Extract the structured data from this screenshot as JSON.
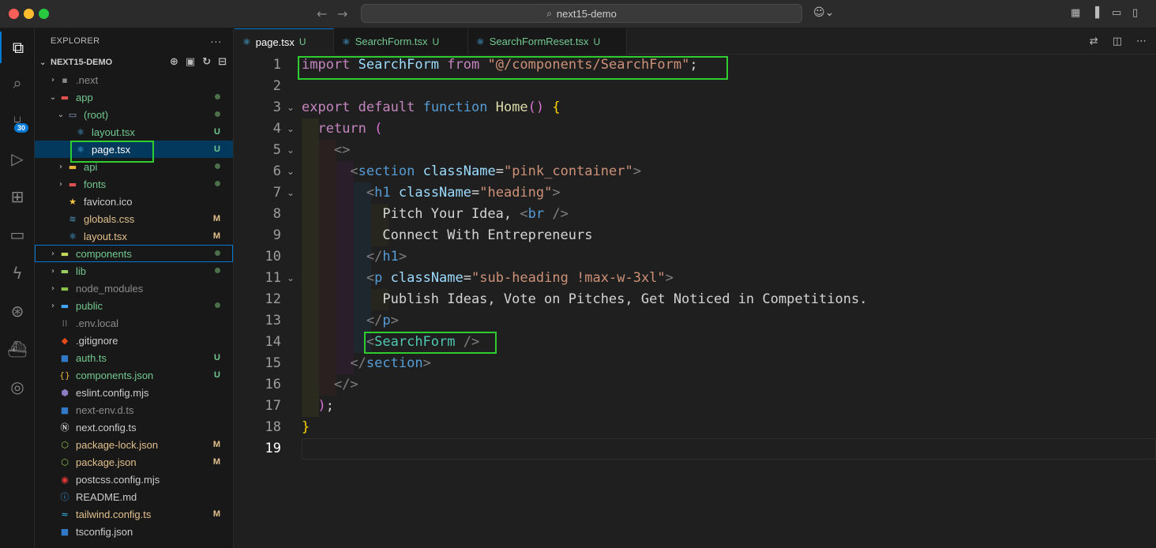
{
  "titlebar": {
    "search_text": "next15-demo",
    "search_icon": "search-icon",
    "copilot_icon": "copilot-icon"
  },
  "activity": {
    "source_control_badge": "30"
  },
  "explorer": {
    "title": "EXPLORER",
    "more": "···",
    "project": "NEXT15-DEMO",
    "items": [
      {
        "label": ".next",
        "status": ""
      },
      {
        "label": "app",
        "status": "•"
      },
      {
        "label": "(root)",
        "status": "•"
      },
      {
        "label": "layout.tsx",
        "status": "U"
      },
      {
        "label": "page.tsx",
        "status": "U"
      },
      {
        "label": "api",
        "status": "•"
      },
      {
        "label": "fonts",
        "status": "•"
      },
      {
        "label": "favicon.ico",
        "status": ""
      },
      {
        "label": "globals.css",
        "status": "M"
      },
      {
        "label": "layout.tsx",
        "status": "M"
      },
      {
        "label": "components",
        "status": "•"
      },
      {
        "label": "lib",
        "status": "•"
      },
      {
        "label": "node_modules",
        "status": ""
      },
      {
        "label": "public",
        "status": "•"
      },
      {
        "label": ".env.local",
        "status": ""
      },
      {
        "label": ".gitignore",
        "status": ""
      },
      {
        "label": "auth.ts",
        "status": "U"
      },
      {
        "label": "components.json",
        "status": "U"
      },
      {
        "label": "eslint.config.mjs",
        "status": ""
      },
      {
        "label": "next-env.d.ts",
        "status": ""
      },
      {
        "label": "next.config.ts",
        "status": ""
      },
      {
        "label": "package-lock.json",
        "status": "M"
      },
      {
        "label": "package.json",
        "status": "M"
      },
      {
        "label": "postcss.config.mjs",
        "status": ""
      },
      {
        "label": "README.md",
        "status": ""
      },
      {
        "label": "tailwind.config.ts",
        "status": "M"
      },
      {
        "label": "tsconfig.json",
        "status": ""
      }
    ]
  },
  "tabs": [
    {
      "label": "page.tsx",
      "status": "U"
    },
    {
      "label": "SearchForm.tsx",
      "status": "U"
    },
    {
      "label": "SearchFormReset.tsx",
      "status": "U"
    }
  ],
  "editor": {
    "line_numbers": [
      "1",
      "2",
      "3",
      "4",
      "5",
      "6",
      "7",
      "8",
      "9",
      "10",
      "11",
      "12",
      "13",
      "14",
      "15",
      "16",
      "17",
      "18",
      "19"
    ],
    "l1": {
      "import": "import",
      "name": "SearchForm",
      "from": "from",
      "path": "\"@/components/SearchForm\"",
      "semi": ";"
    },
    "l3": {
      "export": "export",
      "default": "default",
      "function": "function",
      "name": "Home",
      "parens": "()",
      "brace": "{"
    },
    "l4": {
      "kw": "return",
      "paren": "("
    },
    "l5": {
      "frag": "<>"
    },
    "l6": {
      "open": "<",
      "tag": "section",
      "attr": "className",
      "eq": "=",
      "val": "\"pink_container\"",
      "close": ">"
    },
    "l7": {
      "open": "<",
      "tag": "h1",
      "attr": "className",
      "eq": "=",
      "val": "\"heading\"",
      "close": ">"
    },
    "l8": {
      "text": "Pitch Your Idea, ",
      "br_open": "<",
      "br_tag": "br",
      "br_close": " />"
    },
    "l9": {
      "text": "Connect With Entrepreneurs"
    },
    "l10": {
      "open": "</",
      "tag": "h1",
      "close": ">"
    },
    "l11": {
      "open": "<",
      "tag": "p",
      "attr": "className",
      "eq": "=",
      "val": "\"sub-heading !max-w-3xl\"",
      "close": ">"
    },
    "l12": {
      "text": "Publish Ideas, Vote on Pitches, Get Noticed in Competitions."
    },
    "l13": {
      "open": "</",
      "tag": "p",
      "close": ">"
    },
    "l14": {
      "open": "<",
      "tag": "SearchForm",
      "close": " />"
    },
    "l15": {
      "open": "</",
      "tag": "section",
      "close": ">"
    },
    "l16": {
      "frag": "</>"
    },
    "l17": {
      "paren": ")",
      "semi": ";"
    },
    "l18": {
      "brace": "}"
    }
  }
}
